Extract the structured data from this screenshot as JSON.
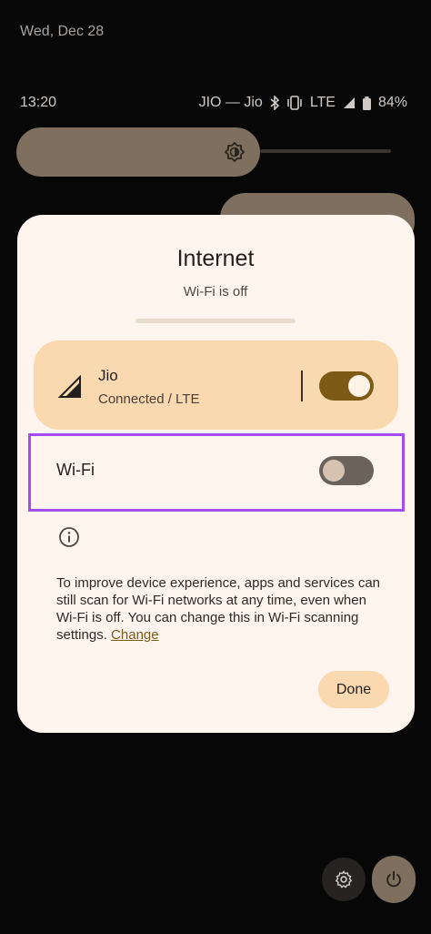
{
  "lockscreen": {
    "date": "Wed, Dec 28"
  },
  "status_bar": {
    "time": "13:20",
    "carrier": "JIO — Jio",
    "network": "LTE",
    "battery": "84%"
  },
  "dialog": {
    "title": "Internet",
    "subtitle": "Wi-Fi is off",
    "mobile_network": {
      "name": "Jio",
      "status": "Connected / LTE",
      "toggle_on": true
    },
    "wifi": {
      "label": "Wi-Fi",
      "toggle_on": false
    },
    "info_text": "To improve device experience, apps and services can still scan for Wi-Fi networks at any time, even when Wi-Fi is off. You can change this in Wi-Fi scanning settings.",
    "info_link": "Change",
    "done_label": "Done"
  },
  "icons": [
    "brightness-icon",
    "signal-icon",
    "info-icon",
    "settings-icon",
    "power-icon",
    "bluetooth-icon",
    "vibrate-icon",
    "battery-icon"
  ],
  "colors": {
    "accent": "#7d5a16",
    "tile": "#fad8b0",
    "dialog_bg": "#fff5ee",
    "highlight": "#a54bf2"
  }
}
